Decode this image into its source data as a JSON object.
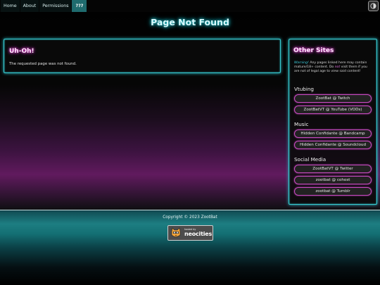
{
  "nav": {
    "items": [
      {
        "label": "Home",
        "active": false
      },
      {
        "label": "About",
        "active": false
      },
      {
        "label": "Permissions",
        "active": false
      },
      {
        "label": "???",
        "active": true
      }
    ],
    "theme_toggle_icon": "half-moon-icon"
  },
  "page": {
    "title": "Page Not Found"
  },
  "main": {
    "heading": "Uh-Oh!",
    "message": "The requested page was not found."
  },
  "sidebar": {
    "heading": "Other Sites",
    "warning": {
      "label": "Warning!",
      "text1": " Any pages linked here may contain mature/18+ content. Do ",
      "emphasis": "not",
      "text2": " visit them if you are not of legal age to view said content!"
    },
    "sections": [
      {
        "title": "Vtubing",
        "links": [
          "ZootBat @ Twitch",
          "ZootBatVT @ YouTube (VODs)"
        ]
      },
      {
        "title": "Music",
        "links": [
          "Hidden Confidante @ Bandcamp",
          "Hidden Confidante @ Soundcloud"
        ]
      },
      {
        "title": "Social Media",
        "links": [
          "ZootBatVT @ Twitter",
          "zootbat @ cohost",
          "zootbat @ Tumblr"
        ]
      }
    ]
  },
  "footer": {
    "copyright": "Copyright © 2023 ZootBat",
    "badge": {
      "small_text": "hosted by",
      "big_text": "neocities",
      "icon": "neocities-cat-icon"
    }
  },
  "colors": {
    "accent_cyan": "#37c9cf",
    "accent_pink": "#c64bbf",
    "nav_active": "#1f6b6e"
  }
}
